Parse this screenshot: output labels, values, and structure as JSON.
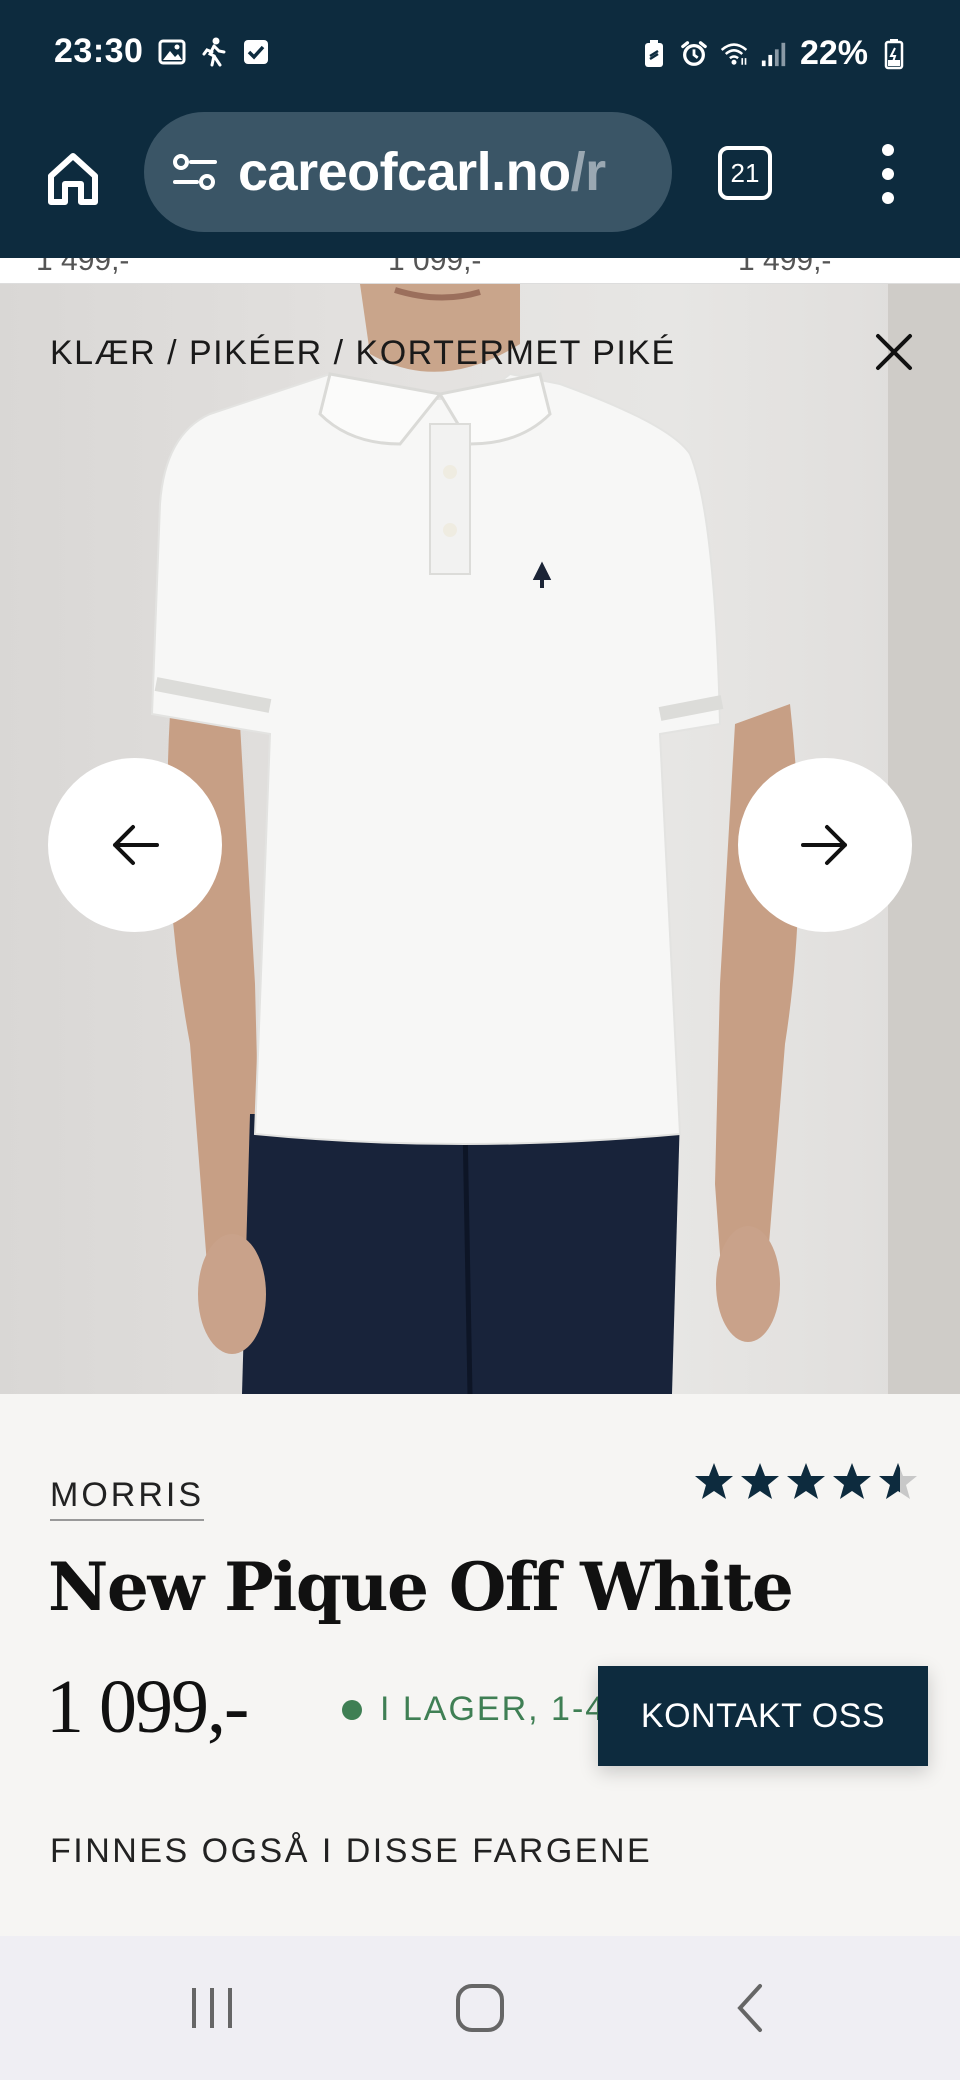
{
  "status_bar": {
    "time": "23:30",
    "battery": "22%",
    "left_icons": [
      "gallery-icon",
      "walking-icon",
      "checkbox-icon"
    ],
    "right_icons": [
      "battery-saver-icon",
      "alarm-icon",
      "wifi-icon",
      "signal-icon",
      "battery-icon"
    ]
  },
  "browser": {
    "url_main": "careofcarl.no",
    "url_rest": "/r",
    "tab_count": "21"
  },
  "price_strip": [
    "1 499,-",
    "1 099,-",
    "1 499,-"
  ],
  "product": {
    "breadcrumb": "KLÆR / PIKÉER / KORTERMET PIKÉ",
    "brand": "MORRIS",
    "rating": 4.5,
    "title": "New Pique Off White",
    "price": "1 099,-",
    "stock": "I LAGER, 1-4",
    "contact_button": "KONTAKT OSS",
    "colors_heading": "FINNES OGSÅ I DISSE FARGENE"
  },
  "colors": {
    "header_bg": "#0d2b3e",
    "button_bg": "#0d2b3e",
    "stock_green": "#3f7f54",
    "page_bg": "#f6f5f3"
  }
}
